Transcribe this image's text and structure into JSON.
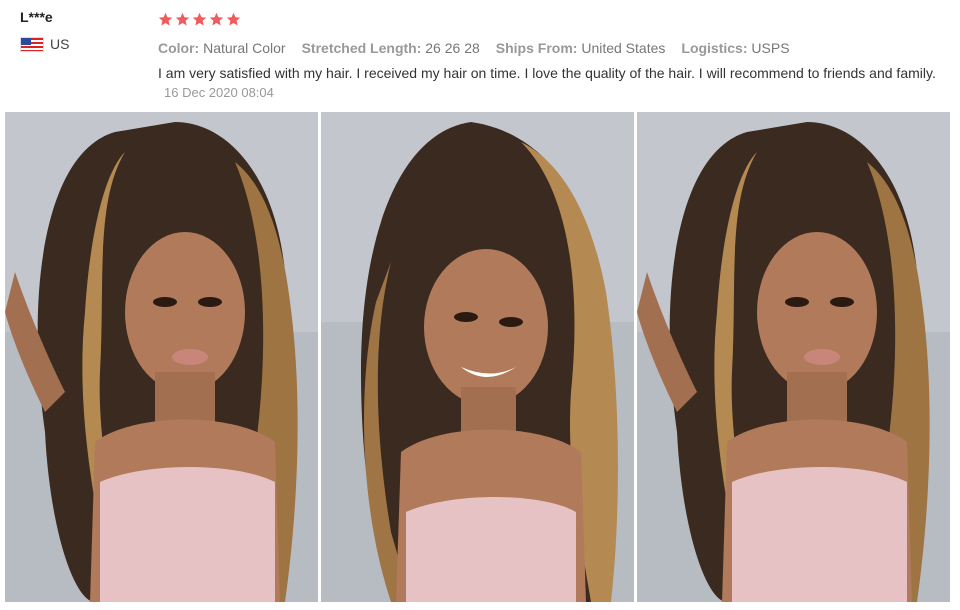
{
  "reviewer": {
    "name": "L***e",
    "country": "US",
    "flag": "us-flag-icon"
  },
  "review": {
    "rating": 5,
    "star_color": "#f05b5b",
    "attributes": [
      {
        "key": "Color:",
        "value": "Natural Color"
      },
      {
        "key": "Stretched Length:",
        "value": "26 26 28"
      },
      {
        "key": "Ships From:",
        "value": "United States"
      },
      {
        "key": "Logistics:",
        "value": "USPS"
      }
    ],
    "text": "I am very satisfied with my hair. I received my hair on time. I love the quality of the hair. I will recommend to friends and family.",
    "date": "16 Dec 2020 08:04"
  },
  "photos": [
    {
      "name": "review-photo-1"
    },
    {
      "name": "review-photo-2"
    },
    {
      "name": "review-photo-3"
    }
  ],
  "colors": {
    "background_wall": "#b7bcc3",
    "hair_dark": "#3b2a1f",
    "hair_highlight": "#b48a52",
    "top": "#e7c2c4",
    "skin": "#b07a5b"
  }
}
